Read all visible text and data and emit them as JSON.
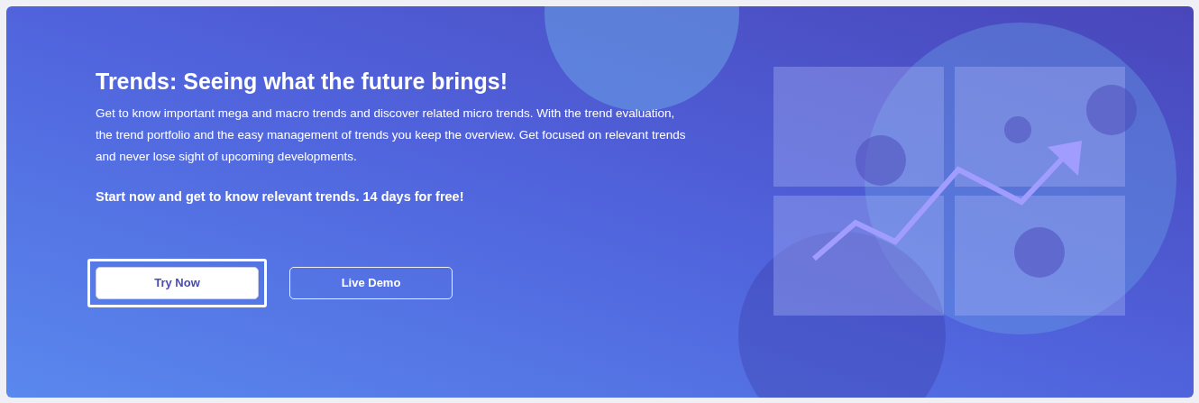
{
  "hero": {
    "title": "Trends: Seeing what the future brings!",
    "description": "Get to know important mega and macro trends and discover related micro trends. With the trend evaluation, the trend portfolio and the easy management of trends you keep the overview. Get focused on relevant trends and never lose sight of upcoming developments.",
    "call_to_action": "Start now and get to know relevant trends. 14 days for free!",
    "buttons": [
      {
        "label": "Try Now",
        "kind": "primary",
        "focused": true
      },
      {
        "label": "Live Demo",
        "kind": "outline",
        "focused": false
      }
    ]
  }
}
